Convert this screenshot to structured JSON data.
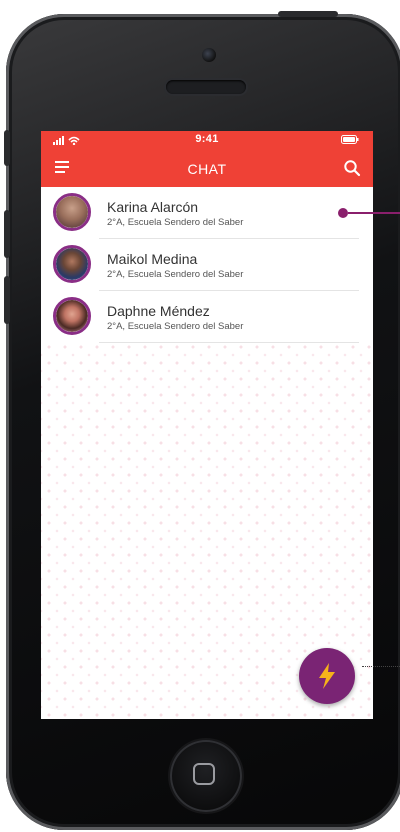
{
  "status_bar": {
    "time": "9:41"
  },
  "header": {
    "title": "CHAT",
    "menu_icon": "hamburger-menu-icon",
    "search_icon": "search-icon",
    "background_color": "#ef4136"
  },
  "chats": [
    {
      "name": "Karina Alarcón",
      "subtitle": "2°A, Escuela Sendero del Saber"
    },
    {
      "name": "Maikol Medina",
      "subtitle": "2°A, Escuela Sendero del Saber"
    },
    {
      "name": "Daphne Méndez",
      "subtitle": "2°A, Escuela Sendero del Saber"
    }
  ],
  "fab": {
    "icon": "lightning-bolt-icon",
    "background_color": "#7a2474",
    "icon_color": "#f6b21a"
  },
  "accent_color": "#8a2e86"
}
